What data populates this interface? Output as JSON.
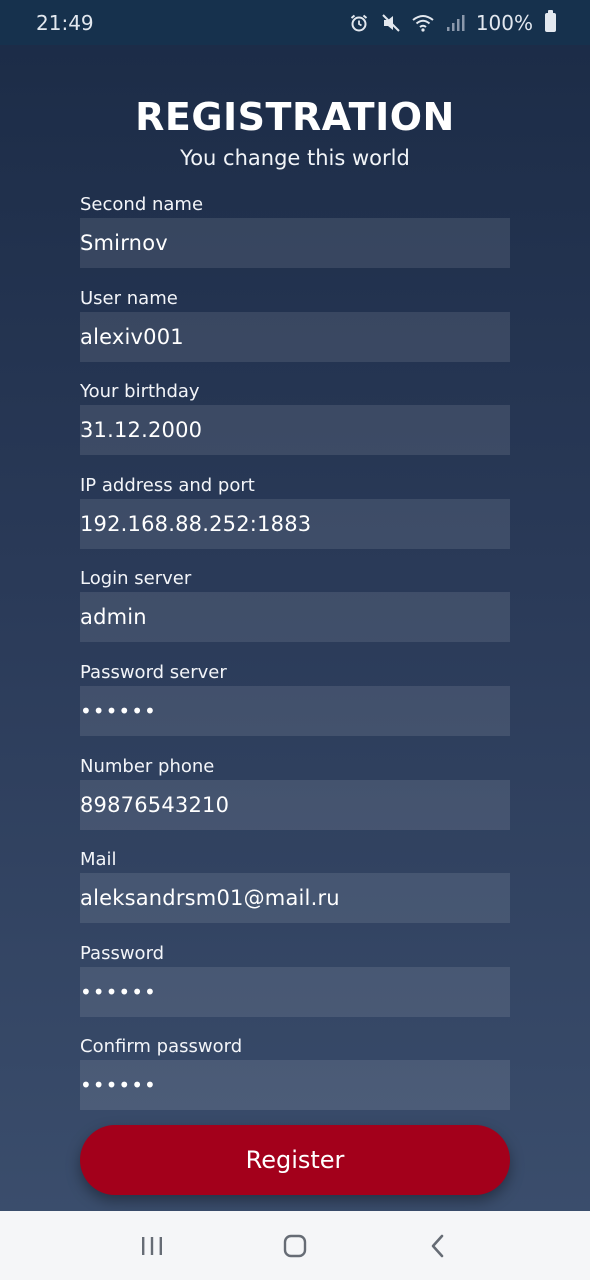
{
  "status_bar": {
    "time": "21:49",
    "battery_text": "100%",
    "icons": [
      "alarm-icon",
      "mute-icon",
      "wifi-icon",
      "signal-icon",
      "battery-icon"
    ]
  },
  "header": {
    "title": "REGISTRATION",
    "subtitle": "You change this world"
  },
  "form": {
    "fields": [
      {
        "label": "Second name",
        "value": "Smirnov"
      },
      {
        "label": "User name",
        "value": "alexiv001"
      },
      {
        "label": "Your birthday",
        "value": "31.12.2000"
      },
      {
        "label": "IP address and port",
        "value": "192.168.88.252:1883"
      },
      {
        "label": "Login server",
        "value": "admin"
      },
      {
        "label": "Password server",
        "value": "••••••"
      },
      {
        "label": "Number phone",
        "value": "89876543210"
      },
      {
        "label": "Mail",
        "value": "aleksandrsm01@mail.ru"
      },
      {
        "label": "Password",
        "value": "••••••"
      },
      {
        "label": "Confirm password",
        "value": "••••••"
      }
    ],
    "submit_label": "Register"
  },
  "nav_bar": {
    "buttons": [
      "recent-apps-icon",
      "home-icon",
      "back-icon"
    ]
  },
  "colors": {
    "background_top": "#1b2b46",
    "background_bottom": "#3c4f6e",
    "status_bar": "#16314d",
    "button": "#a3001b",
    "nav_bar": "#f5f6f8"
  }
}
